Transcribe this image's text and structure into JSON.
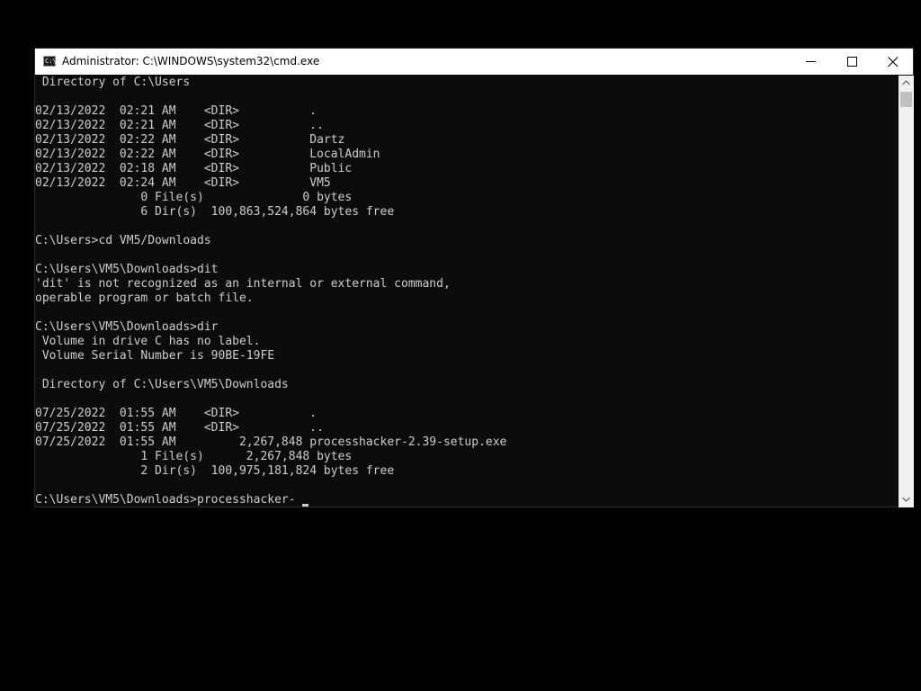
{
  "window": {
    "title": "Administrator: C:\\WINDOWS\\system32\\cmd.exe",
    "icon_label": "C:\\",
    "controls": [
      "minimize-icon",
      "maximize-icon",
      "close-icon"
    ]
  },
  "console": {
    "lines": [
      " Directory of C:\\Users",
      "",
      "02/13/2022  02:21 AM    <DIR>          .",
      "02/13/2022  02:21 AM    <DIR>          ..",
      "02/13/2022  02:22 AM    <DIR>          Dartz",
      "02/13/2022  02:22 AM    <DIR>          LocalAdmin",
      "02/13/2022  02:18 AM    <DIR>          Public",
      "02/13/2022  02:24 AM    <DIR>          VM5",
      "               0 File(s)              0 bytes",
      "               6 Dir(s)  100,863,524,864 bytes free",
      "",
      "C:\\Users>cd VM5/Downloads",
      "",
      "C:\\Users\\VM5\\Downloads>dit",
      "'dit' is not recognized as an internal or external command,",
      "operable program or batch file.",
      "",
      "C:\\Users\\VM5\\Downloads>dir",
      " Volume in drive C has no label.",
      " Volume Serial Number is 90BE-19FE",
      "",
      " Directory of C:\\Users\\VM5\\Downloads",
      "",
      "07/25/2022  01:55 AM    <DIR>          .",
      "07/25/2022  01:55 AM    <DIR>          ..",
      "07/25/2022  01:55 AM         2,267,848 processhacker-2.39-setup.exe",
      "               1 File(s)      2,267,848 bytes",
      "               2 Dir(s)  100,975,181,824 bytes free",
      "",
      "C:\\Users\\VM5\\Downloads>processhacker-"
    ]
  },
  "colors": {
    "background": "#0c0c0c",
    "text": "#cccccc",
    "titlebar": "#ffffff"
  }
}
